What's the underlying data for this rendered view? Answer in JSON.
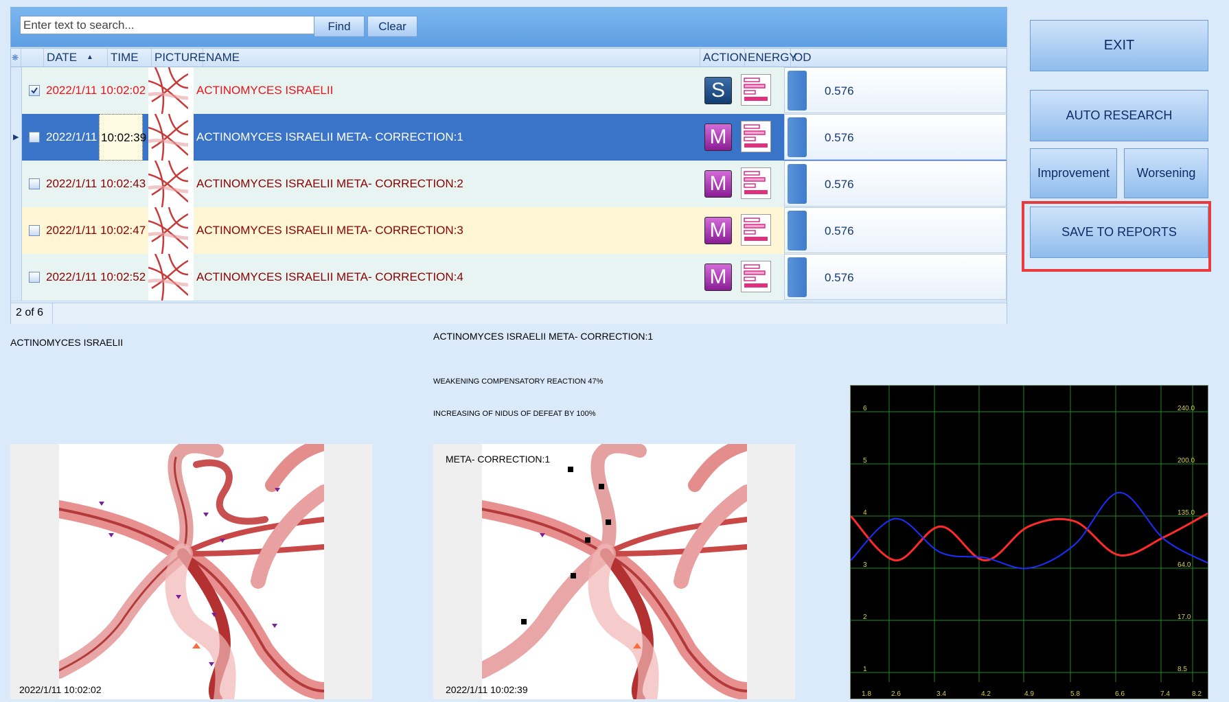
{
  "search": {
    "placeholder": "Enter text to search...",
    "find_label": "Find",
    "clear_label": "Clear"
  },
  "columns": [
    {
      "key": "settings",
      "label": "❋"
    },
    {
      "key": "date",
      "label": "DATE"
    },
    {
      "key": "time",
      "label": "TIME"
    },
    {
      "key": "picture",
      "label": "PICTURE"
    },
    {
      "key": "name",
      "label": "NAME"
    },
    {
      "key": "action",
      "label": "ACTION"
    },
    {
      "key": "energy",
      "label": "ENERGY"
    },
    {
      "key": "od",
      "label": "OD"
    }
  ],
  "rows": [
    {
      "checked": true,
      "selected": false,
      "date": "2022/1/11",
      "time": "10:02:02",
      "name": "ACTINOMYCES  ISRAELII",
      "action": "S",
      "od": "0.576"
    },
    {
      "checked": false,
      "selected": true,
      "date": "2022/1/11",
      "time": "10:02:39",
      "name": "ACTINOMYCES  ISRAELII META- CORRECTION:1",
      "action": "M",
      "od": "0.576"
    },
    {
      "checked": false,
      "selected": false,
      "date": "2022/1/11",
      "time": "10:02:43",
      "name": "ACTINOMYCES  ISRAELII META- CORRECTION:2",
      "action": "M",
      "od": "0.576"
    },
    {
      "checked": false,
      "selected": false,
      "date": "2022/1/11",
      "time": "10:02:47",
      "name": "ACTINOMYCES  ISRAELII META- CORRECTION:3",
      "action": "M",
      "od": "0.576"
    },
    {
      "checked": false,
      "selected": false,
      "date": "2022/1/11",
      "time": "10:02:52",
      "name": "ACTINOMYCES  ISRAELII META- CORRECTION:4",
      "action": "M",
      "od": "0.576"
    }
  ],
  "pager": {
    "label": "2 of 6"
  },
  "buttons": {
    "exit": "EXIT",
    "auto_research": "AUTO RESEARCH",
    "improvement": "Improvement",
    "worsening": "Worsening",
    "save_reports": "SAVE TO  REPORTS"
  },
  "left_panel": {
    "title": "ACTINOMYCES  ISRAELII",
    "timestamp": "2022/1/11 10:02:02"
  },
  "mid_panel": {
    "title": "ACTINOMYCES  ISRAELII META- CORRECTION:1",
    "note1": "WEAKENING COMPENSATORY REACTION 47%",
    "note2": "INCREASING OF NIDUS OF DEFEAT BY 100%",
    "overlay": "META- CORRECTION:1",
    "timestamp": "2022/1/11 10:02:39"
  },
  "colors": {
    "row_text_red": "#e8141a",
    "row_text_dark": "#8b0000",
    "selected_row": "#3a74c8",
    "s_button": "#1b4f8c",
    "m_button": "#b02ab5",
    "series_red": "#ff2a2a",
    "series_blue": "#1a2fff",
    "grid_green": "#1f8a1f"
  },
  "chart_data": {
    "type": "line",
    "x": [
      1.8,
      2.6,
      3.4,
      4.2,
      4.9,
      5.8,
      6.6,
      7.4,
      8.2
    ],
    "y_left_ticks": [
      1,
      2,
      3,
      4,
      5,
      6
    ],
    "y_right_ticks": [
      "8.5",
      "17.0",
      "64.0",
      "135.0",
      "200.0",
      "240.0"
    ],
    "ylim": [
      0.5,
      6.5
    ],
    "series": [
      {
        "color": "red",
        "values": [
          4.0,
          3.15,
          3.8,
          3.15,
          3.8,
          3.9,
          3.25,
          3.6,
          4.05
        ]
      },
      {
        "color": "blue",
        "values": [
          3.15,
          3.95,
          3.3,
          3.2,
          3.0,
          3.45,
          4.45,
          3.55,
          3.1
        ]
      }
    ]
  }
}
